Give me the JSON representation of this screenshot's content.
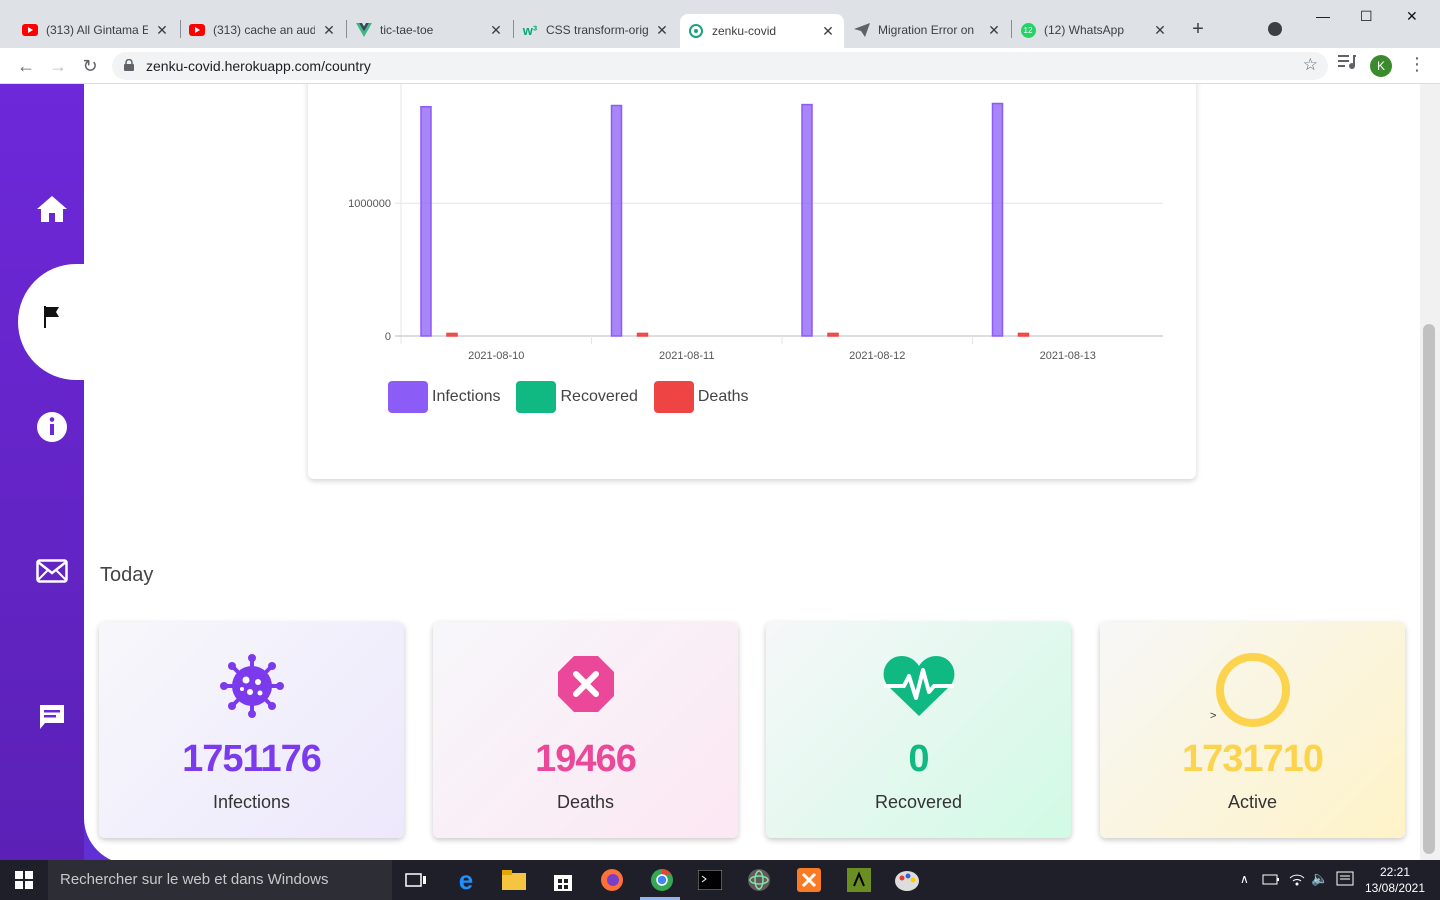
{
  "browser": {
    "tabs": [
      {
        "title": "(313) All Gintama E",
        "icon": "youtube-icon",
        "active": false
      },
      {
        "title": "(313) cache an aud",
        "icon": "youtube-icon",
        "active": false
      },
      {
        "title": "tic-tae-toe",
        "icon": "vue-icon",
        "active": false
      },
      {
        "title": "CSS transform-orig",
        "icon": "w3-icon",
        "active": false
      },
      {
        "title": "zenku-covid",
        "icon": "shield-favicon-icon",
        "active": true
      },
      {
        "title": "Migration Error on",
        "icon": "paper-plane-icon",
        "active": false
      },
      {
        "title": "(12) WhatsApp",
        "icon": "whatsapp-icon",
        "active": false
      }
    ],
    "url": "zenku-covid.herokuapp.com/country",
    "profile_initial": "K",
    "whatsapp_badge": "12"
  },
  "chart_data": {
    "type": "bar",
    "categories": [
      "2021-08-10",
      "2021-08-11",
      "2021-08-12",
      "2021-08-13"
    ],
    "series": [
      {
        "name": "Infections",
        "values": [
          1727000,
          1736000,
          1743000,
          1751176
        ],
        "color": "#8b5cf6"
      },
      {
        "name": "Recovered",
        "values": [
          0,
          0,
          0,
          0
        ],
        "color": "#10b981"
      },
      {
        "name": "Deaths",
        "values": [
          19300,
          19360,
          19410,
          19466
        ],
        "color": "#ef4444"
      }
    ],
    "yticks": [
      "0",
      "1000000"
    ],
    "ylim": [
      0,
      1770000
    ],
    "grid": true,
    "legend_position": "bottom-left"
  },
  "today": {
    "heading": "Today",
    "cards": [
      {
        "value": "1751176",
        "label": "Infections",
        "color": "#7c3aed",
        "icon": "virus-icon"
      },
      {
        "value": "19466",
        "label": "Deaths",
        "color": "#ec4899",
        "icon": "x-octagon-icon"
      },
      {
        "value": "0",
        "label": "Recovered",
        "color": "#10b981",
        "icon": "heartbeat-icon"
      },
      {
        "value": "1731710",
        "label": "Active",
        "color": "#fcd34d",
        "icon": "ring-icon",
        "marker": ">"
      }
    ]
  },
  "taskbar": {
    "search_placeholder": "Rechercher sur le web et dans Windows",
    "time": "22:21",
    "date": "13/08/2021"
  }
}
